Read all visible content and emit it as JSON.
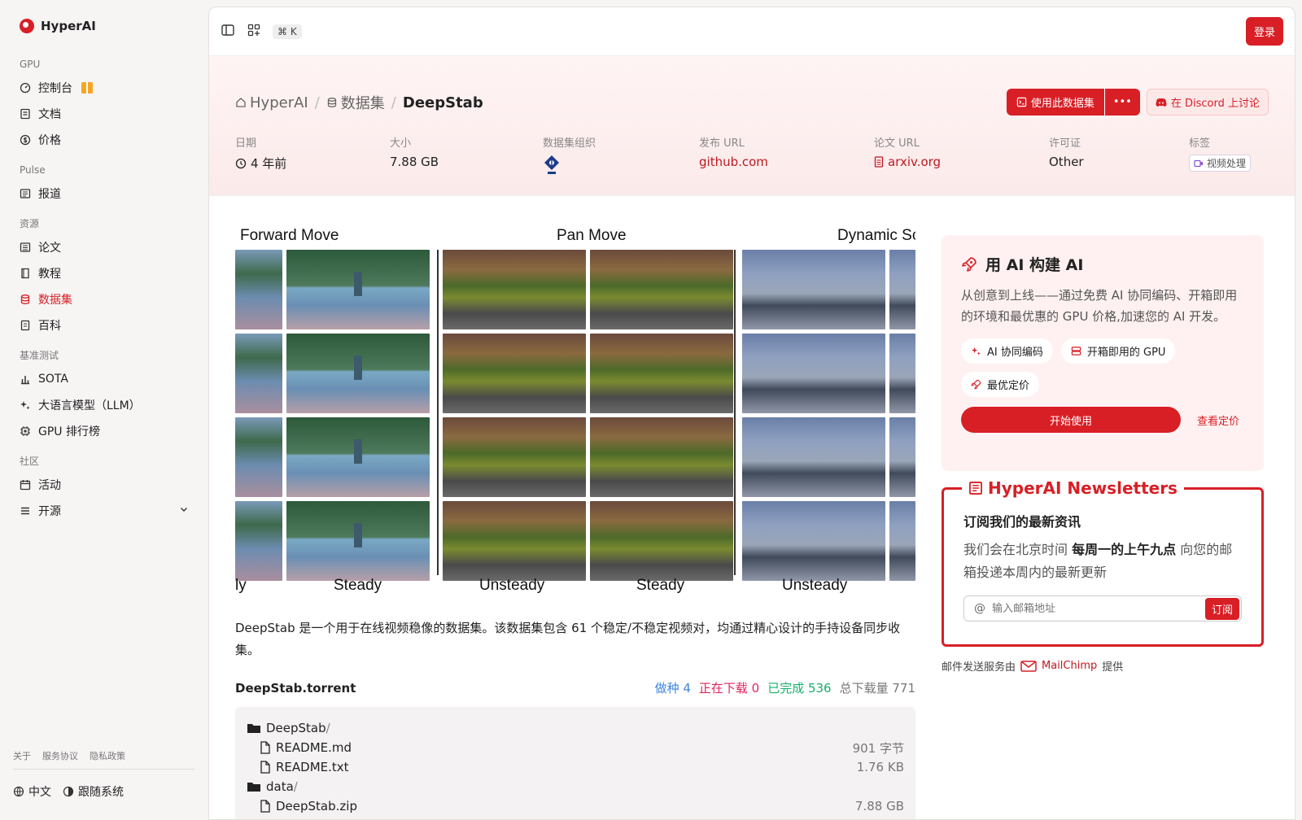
{
  "app": {
    "name": "HyperAI"
  },
  "sidebar": {
    "groups": {
      "gpu": "GPU",
      "pulse": "Pulse",
      "resources": "资源",
      "bench": "基准测试",
      "community": "社区"
    },
    "items": {
      "console": "控制台",
      "docs": "文档",
      "pricing": "价格",
      "reports": "报道",
      "papers": "论文",
      "tutorials": "教程",
      "datasets": "数据集",
      "wiki": "百科",
      "sota": "SOTA",
      "llm": "大语言模型（LLM）",
      "gpu_rank": "GPU 排行榜",
      "events": "活动",
      "open_source": "开源"
    },
    "footer": {
      "about": "关于",
      "terms": "服务协议",
      "privacy": "隐私政策",
      "lang": "中文",
      "theme": "跟随系统"
    }
  },
  "topbar": {
    "shortcut": "⌘ K",
    "login": "登录"
  },
  "breadcrumb": {
    "home": "HyperAI",
    "section": "数据集",
    "current": "DeepStab"
  },
  "actions": {
    "use": "使用此数据集",
    "more": "•••",
    "discord": "在 Discord 上讨论"
  },
  "meta": {
    "date": {
      "label": "日期",
      "value": "4 年前"
    },
    "size": {
      "label": "大小",
      "value": "7.88 GB"
    },
    "org": {
      "label": "数据集组织"
    },
    "release_url": {
      "label": "发布 URL",
      "value": "github.com"
    },
    "paper_url": {
      "label": "论文 URL",
      "value": "arxiv.org"
    },
    "license": {
      "label": "许可证",
      "value": "Other"
    },
    "tags": {
      "label": "标签",
      "value": "视频处理"
    }
  },
  "preview": {
    "headers": [
      "Forward Move",
      "Pan Move",
      "Dynamic Sc"
    ],
    "footers": [
      "ly",
      "Steady",
      "Unsteady",
      "Steady",
      "Unsteady"
    ]
  },
  "description": "DeepStab 是一个用于在线视频稳像的数据集。该数据集包含 61 个稳定/不稳定视频对，均通过精心设计的手持设备同步收集。",
  "torrent": {
    "name": "DeepStab.torrent",
    "seeding": "做种 4",
    "downloading": "正在下载 0",
    "completed": "已完成 536",
    "total": "总下载量 771",
    "files": [
      {
        "name": "DeepStab",
        "type": "folder",
        "size": ""
      },
      {
        "name": "README.md",
        "type": "file",
        "size": "901 字节"
      },
      {
        "name": "README.txt",
        "type": "file",
        "size": "1.76 KB"
      },
      {
        "name": "data",
        "type": "folder",
        "size": ""
      },
      {
        "name": "DeepStab.zip",
        "type": "file",
        "size": "7.88 GB"
      }
    ]
  },
  "promo": {
    "title": "用 AI 构建 AI",
    "text": "从创意到上线——通过免费 AI 协同编码、开箱即用的环境和最优惠的 GPU 价格,加速您的 AI 开发。",
    "chips": [
      "AI 协同编码",
      "开箱即用的 GPU",
      "最优定价"
    ],
    "start": "开始使用",
    "view_price": "查看定价"
  },
  "newsletter": {
    "title": "HyperAI Newsletters",
    "heading": "订阅我们的最新资讯",
    "text_pre": "我们会在北京时间 ",
    "text_bold": "每周一的上午九点",
    "text_post": " 向您的邮箱投递本周内的最新更新",
    "placeholder": "输入邮箱地址",
    "button": "订阅",
    "by_pre": "邮件发送服务由",
    "by_brand": "MailChimp",
    "by_post": "提供"
  },
  "colors": {
    "accent": "#d81f26"
  }
}
